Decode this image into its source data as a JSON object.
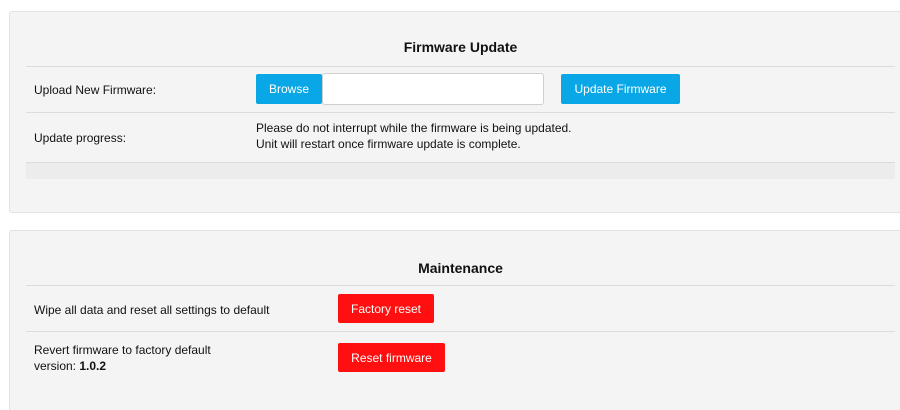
{
  "firmware_update": {
    "title": "Firmware Update",
    "upload_label": "Upload New Firmware:",
    "browse_label": "Browse",
    "file_value": "",
    "update_button_label": "Update Firmware",
    "progress_label": "Update progress:",
    "message_line1": "Please do not interrupt while the firmware is being updated.",
    "message_line2": "Unit will restart once firmware update is complete."
  },
  "maintenance": {
    "title": "Maintenance",
    "wipe_label": "Wipe all data and reset all settings to default",
    "factory_reset_label": "Factory reset",
    "revert_label": "Revert firmware to factory default",
    "version_prefix": "version: ",
    "version_value": "1.0.2",
    "reset_firmware_label": "Reset firmware"
  },
  "colors": {
    "primary_button": "#0aa7e6",
    "danger_button": "#ff0f0f"
  }
}
